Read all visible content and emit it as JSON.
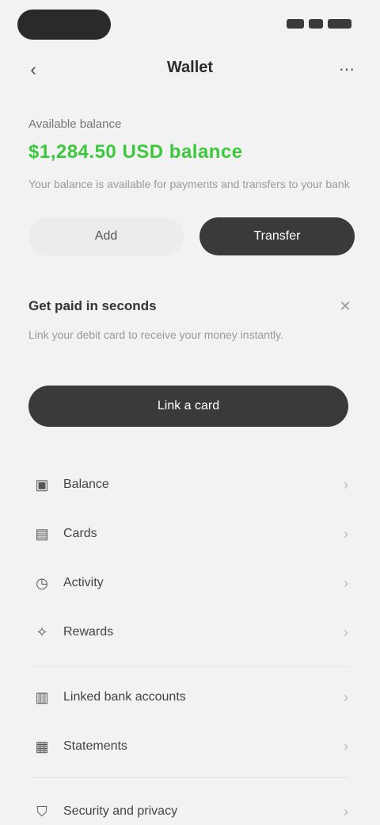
{
  "nav": {
    "back_icon": "back-arrow-icon",
    "title": "Wallet",
    "more_icon": "more-icon"
  },
  "balance": {
    "label": "Available balance",
    "value": "$1,284.50 USD balance",
    "note": "Your balance is available for payments and transfers to your bank"
  },
  "actions": {
    "secondary_label": "Add",
    "primary_label": "Transfer"
  },
  "promo": {
    "title": "Get paid in seconds",
    "text": "Link your debit card to receive your money instantly.",
    "button_label": "Link a card"
  },
  "list_group_1": [
    {
      "icon": "wallet-icon",
      "label": "Balance"
    },
    {
      "icon": "card-icon",
      "label": "Cards"
    },
    {
      "icon": "history-icon",
      "label": "Activity"
    },
    {
      "icon": "gift-icon",
      "label": "Rewards"
    }
  ],
  "list_group_2": [
    {
      "icon": "bank-icon",
      "label": "Linked bank accounts"
    },
    {
      "icon": "statement-icon",
      "label": "Statements"
    }
  ],
  "list_group_3": [
    {
      "icon": "shield-icon",
      "label": "Security and privacy"
    }
  ]
}
